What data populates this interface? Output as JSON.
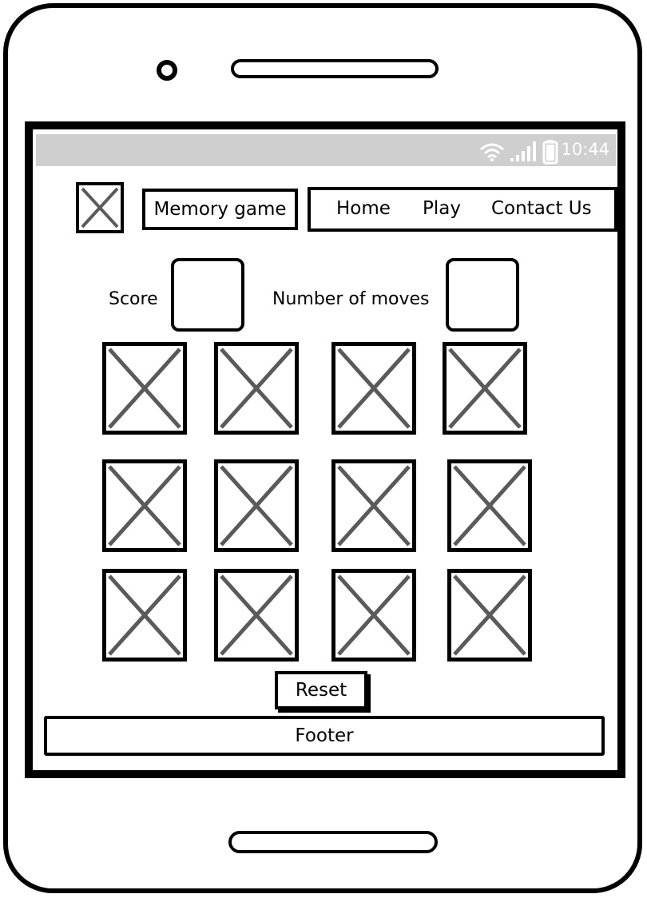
{
  "status_bar": {
    "time": "10:44",
    "icons": [
      "wifi-icon",
      "signal-icon",
      "battery-icon"
    ]
  },
  "header": {
    "logo_icon": "image-placeholder-icon",
    "brand": "Memory game",
    "nav": [
      "Home",
      "Play",
      "Contact Us"
    ]
  },
  "stats": {
    "score_label": "Score",
    "moves_label": "Number of moves"
  },
  "board": {
    "rows": 3,
    "columns": 4,
    "card_icon": "image-placeholder-icon"
  },
  "reset_label": "Reset",
  "footer_label": "Footer",
  "colors": {
    "frame": "#000000",
    "status_bar": "#cfcfcf",
    "placeholder_cross": "#5a5a5a"
  }
}
